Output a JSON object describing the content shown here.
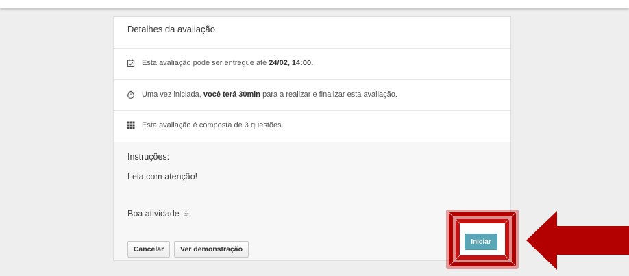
{
  "card": {
    "title": "Detalhes da avaliação",
    "rows": [
      {
        "icon": "calendar-check-icon",
        "pre": "Esta avaliação pode ser entregue até ",
        "bold": "24/02, 14:00.",
        "post": ""
      },
      {
        "icon": "stopwatch-icon",
        "pre": "Uma vez iniciada, ",
        "bold": "você terá 30min",
        "post": " para a realizar e finalizar esta avaliação."
      },
      {
        "icon": "grid-icon",
        "pre": "Esta avaliação é composta de 3 questões.",
        "bold": "",
        "post": ""
      }
    ],
    "instructions": {
      "title": "Instruções:",
      "line1": "Leia com atenção!",
      "line2": "Boa atividade ☺"
    },
    "buttons": {
      "cancel": "Cancelar",
      "demo": "Ver demonstração",
      "start": "Iniciar"
    }
  },
  "colors": {
    "start_button": "#5aa6b7",
    "highlight": "#c00000",
    "arrow": "#b30000"
  }
}
